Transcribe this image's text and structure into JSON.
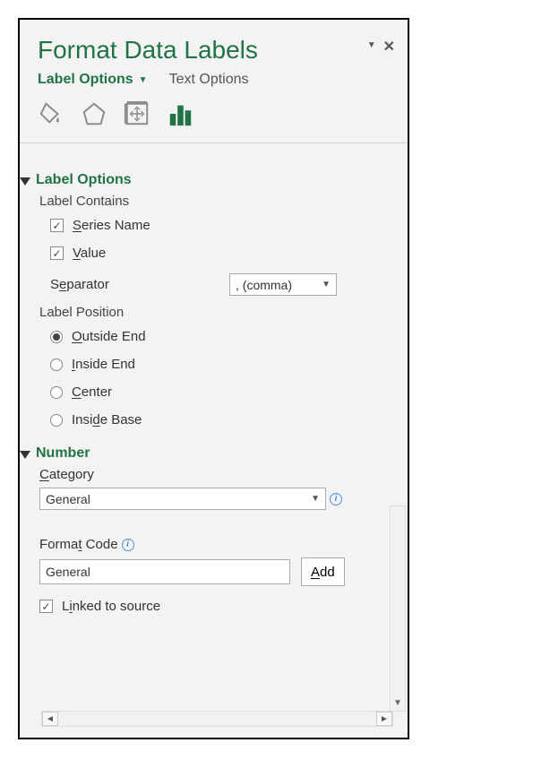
{
  "header": {
    "title": "Format Data Labels"
  },
  "tabs": {
    "active": "Label Options",
    "inactive": "Text Options"
  },
  "section1": {
    "title": "Label Options",
    "label_contains": "Label Contains",
    "series_pre": "S",
    "series_post": "eries Name",
    "value_pre": "V",
    "value_post": "alue",
    "sep_label_pre": "S",
    "sep_label_mid": "e",
    "sep_label_post": "parator",
    "sep_value": ", (comma)",
    "label_position": "Label Position",
    "pos1_pre": "O",
    "pos1_post": "utside End",
    "pos2_pre": "I",
    "pos2_post": "nside End",
    "pos3_pre": "C",
    "pos3_post": "enter",
    "pos4_pre": "Insi",
    "pos4_mid": "d",
    "pos4_post": "e Base"
  },
  "section2": {
    "title": "Number",
    "category_pre": "C",
    "category_post": "ategory",
    "category_value": "General",
    "format_code_pre": "Forma",
    "format_code_mid": "t",
    "format_code_post": " Code",
    "format_code_value": "General",
    "add_pre": "A",
    "add_post": "dd",
    "linked_pre": "L",
    "linked_mid": "i",
    "linked_post": "nked to source"
  }
}
